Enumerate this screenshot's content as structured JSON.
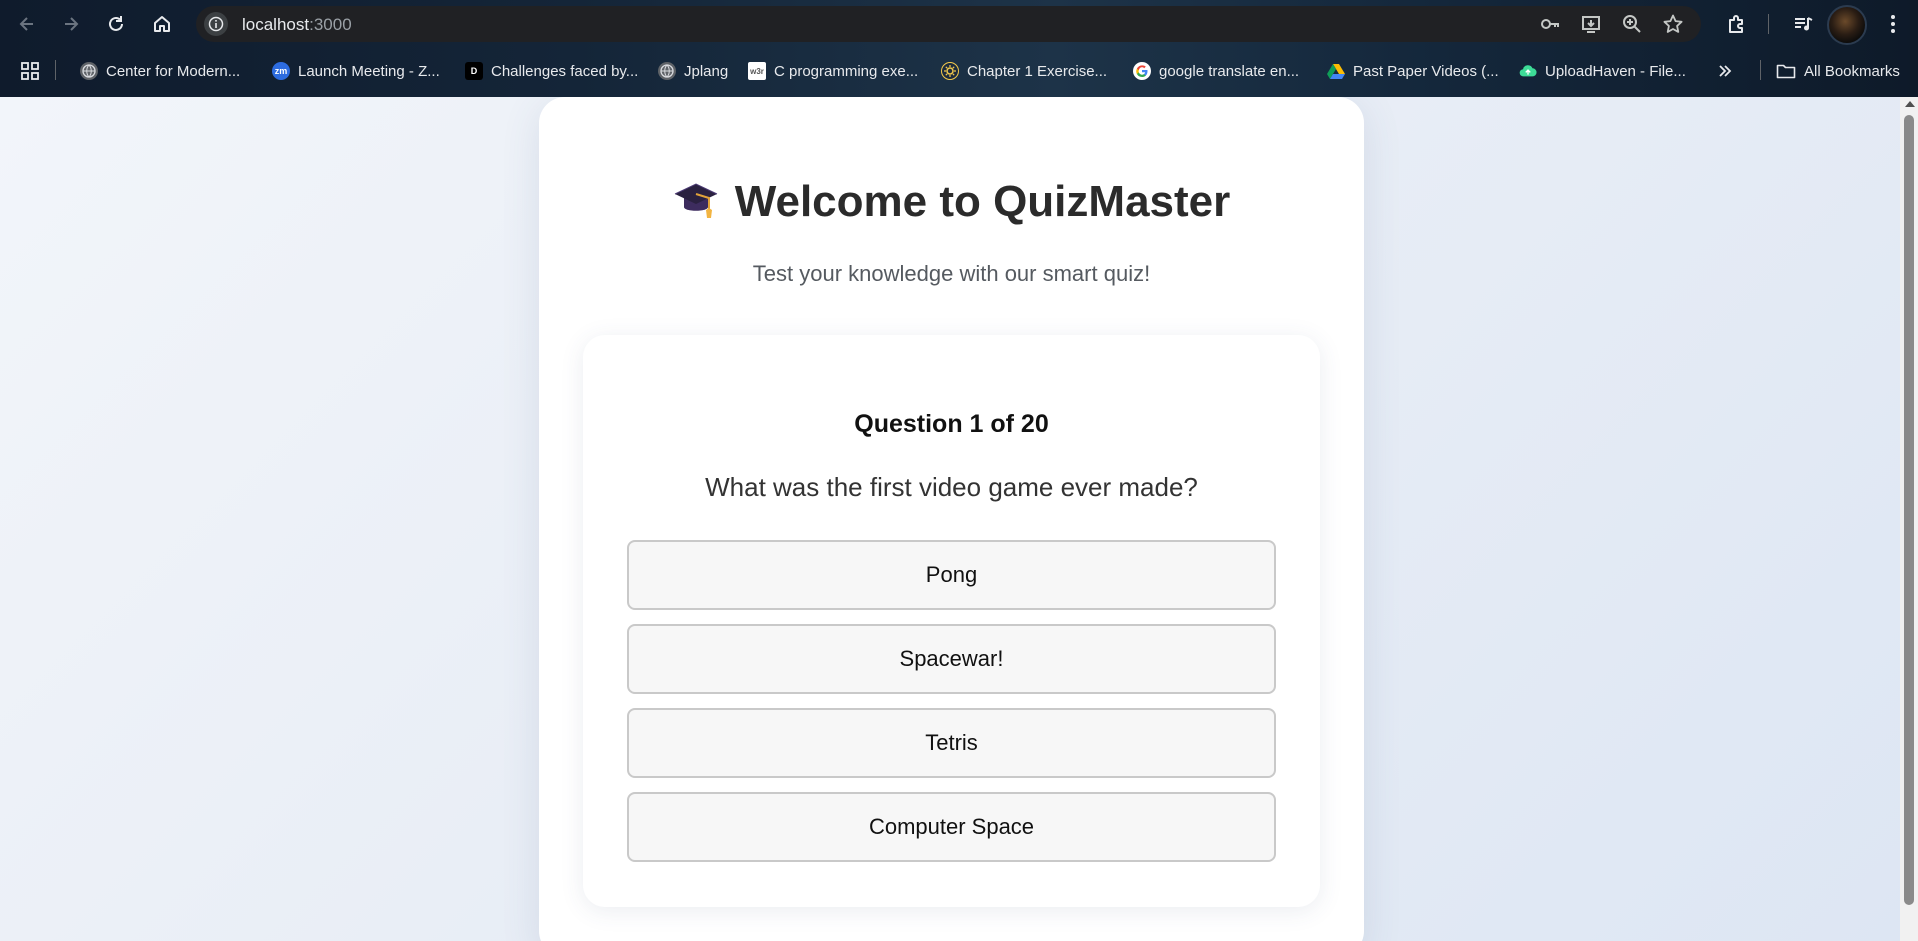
{
  "browser": {
    "url_host": "localhost",
    "url_port": ":3000",
    "bookmarks": [
      {
        "label": "Center for Modern...",
        "icon": "globe-icon"
      },
      {
        "label": "Launch Meeting - Z...",
        "icon": "zoom-icon"
      },
      {
        "label": "Challenges faced by...",
        "icon": "d-icon"
      },
      {
        "label": "Jplang",
        "icon": "globe-icon"
      },
      {
        "label": "C programming exe...",
        "icon": "w3r-icon"
      },
      {
        "label": "Chapter 1 Exercise...",
        "icon": "gear-icon"
      },
      {
        "label": "google translate en...",
        "icon": "google-icon"
      },
      {
        "label": "Past Paper Videos (...",
        "icon": "drive-icon"
      },
      {
        "label": "UploadHaven - File...",
        "icon": "cloud-icon"
      }
    ],
    "all_bookmarks": "All Bookmarks",
    "favicon_text": {
      "zoom": "zm",
      "d": "D",
      "w3r": "w3r"
    }
  },
  "page": {
    "title": "Welcome to QuizMaster",
    "subtitle": "Test your knowledge with our smart quiz!",
    "question_counter": "Question 1 of 20",
    "question_text": "What was the first video game ever made?",
    "options": [
      "Pong",
      "Spacewar!",
      "Tetris",
      "Computer Space"
    ]
  }
}
